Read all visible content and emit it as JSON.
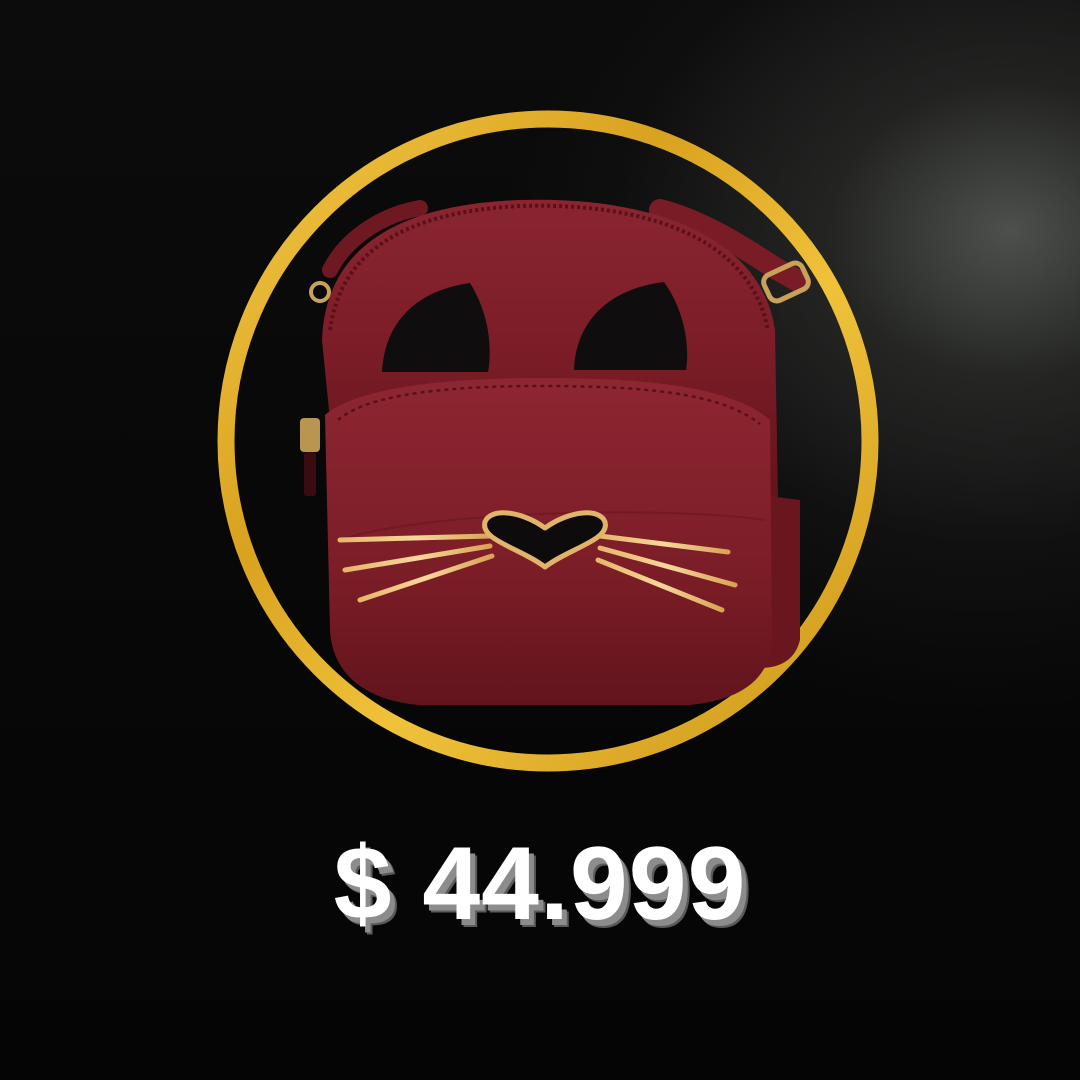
{
  "product": {
    "price_label": "$ 44.999",
    "image_icon": "cat-face-crossbody-bag-icon"
  },
  "colors": {
    "ring_gold": "#e8b52a",
    "bag_red": "#7a1c25",
    "background": "#050505",
    "price_text": "#ffffff"
  }
}
